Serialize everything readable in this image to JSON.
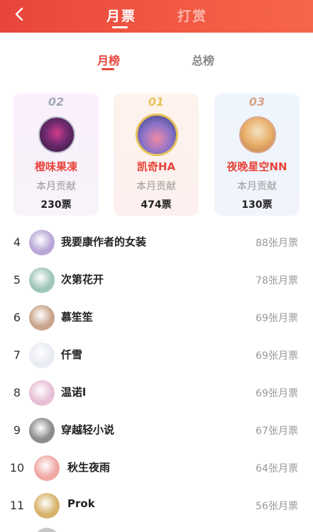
{
  "header": {
    "tabs": [
      {
        "label": "月票",
        "active": true
      },
      {
        "label": "打赏",
        "active": false
      }
    ]
  },
  "subtabs": [
    {
      "label": "月榜",
      "active": true
    },
    {
      "label": "总榜",
      "active": false
    }
  ],
  "podium": [
    {
      "rank": "02",
      "name": "橙味果凍",
      "label": "本月贡献",
      "votes": "230票"
    },
    {
      "rank": "01",
      "name": "凯奇HA",
      "label": "本月贡献",
      "votes": "474票"
    },
    {
      "rank": "03",
      "name": "夜晚星空NN",
      "label": "本月贡献",
      "votes": "130票"
    }
  ],
  "list": [
    {
      "rank": "4",
      "name": "我要康作者的女装",
      "votes": "88张月票",
      "avatar_color": "#b9a6d8"
    },
    {
      "rank": "5",
      "name": "次第花开",
      "votes": "78张月票",
      "avatar_color": "#9ec6b6"
    },
    {
      "rank": "6",
      "name": "慕笙笙",
      "votes": "69张月票",
      "avatar_color": "#c9a48a"
    },
    {
      "rank": "7",
      "name": "仟雪",
      "votes": "69张月票",
      "avatar_color": "#e9ecf3"
    },
    {
      "rank": "8",
      "name": "温诺l",
      "votes": "69张月票",
      "avatar_color": "#e8bfd6"
    },
    {
      "rank": "9",
      "name": "穿越轻小说",
      "votes": "67张月票",
      "avatar_color": "#8c8c8c"
    },
    {
      "rank": "10",
      "name": "秋生夜雨",
      "votes": "64张月票",
      "avatar_color": "#f0a7a2"
    },
    {
      "rank": "11",
      "name": "Prok",
      "votes": "56张月票",
      "avatar_color": "#d7b26a"
    }
  ]
}
